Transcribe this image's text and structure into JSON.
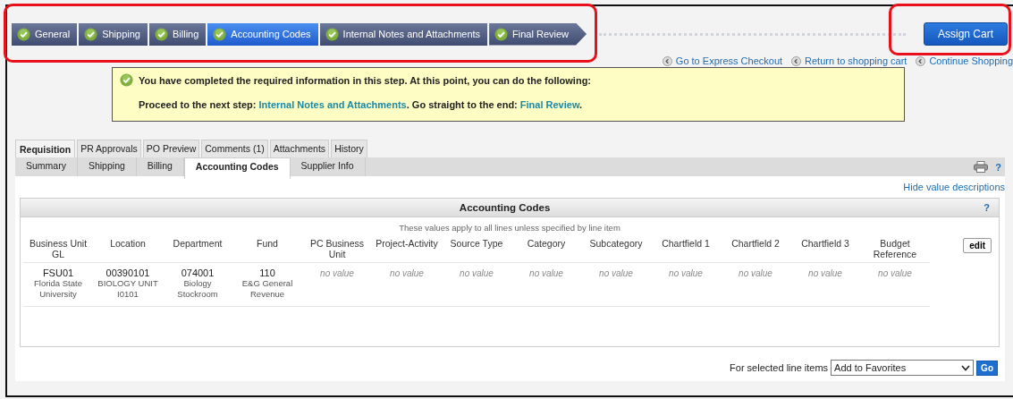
{
  "steps": [
    {
      "label": "General",
      "completed": true,
      "selected": false
    },
    {
      "label": "Shipping",
      "completed": true,
      "selected": false
    },
    {
      "label": "Billing",
      "completed": true,
      "selected": false
    },
    {
      "label": "Accounting Codes",
      "completed": true,
      "selected": true
    },
    {
      "label": "Internal Notes and Attachments",
      "completed": true,
      "selected": false
    },
    {
      "label": "Final Review",
      "completed": true,
      "selected": false
    }
  ],
  "assign_button": "Assign Cart",
  "links": [
    "Go to Express Checkout",
    "Return to shopping cart",
    "Continue Shopping"
  ],
  "message": {
    "title": "You have completed the required information in this step. At this point, you can do the following:",
    "segments": [
      {
        "kind": "text",
        "text": "Proceed to the next step: "
      },
      {
        "kind": "link",
        "text": "Internal Notes and Attachments"
      },
      {
        "kind": "text",
        "text": ". Go straight to the end: "
      },
      {
        "kind": "link",
        "text": "Final Review"
      },
      {
        "kind": "text",
        "text": "."
      }
    ]
  },
  "tabs": [
    {
      "label": "Requisition",
      "selected": true
    },
    {
      "label": "PR Approvals",
      "selected": false
    },
    {
      "label": "PO Preview",
      "selected": false
    },
    {
      "label": "Comments (1)",
      "selected": false
    },
    {
      "label": "Attachments",
      "selected": false
    },
    {
      "label": "History",
      "selected": false
    }
  ],
  "subtabs": [
    {
      "label": "Summary",
      "selected": false
    },
    {
      "label": "Shipping",
      "selected": false
    },
    {
      "label": "Billing",
      "selected": false
    },
    {
      "label": "Accounting Codes",
      "selected": true
    },
    {
      "label": "Supplier Info",
      "selected": false
    }
  ],
  "help": "?",
  "hide_link": "Hide value descriptions",
  "panel": {
    "title": "Accounting Codes",
    "help": "?",
    "subtitle": "These values apply to all lines unless specified by line item",
    "edit_button": "edit",
    "columns": [
      "Business Unit GL",
      "Location",
      "Department",
      "Fund",
      "PC Business Unit",
      "Project-Activity",
      "Source Type",
      "Category",
      "Subcategory",
      "Chartfield 1",
      "Chartfield 2",
      "Chartfield 3",
      "Budget Reference"
    ],
    "rows": [
      {
        "cells": [
          {
            "kind": "code",
            "code": "FSU01",
            "description": "Florida State University"
          },
          {
            "kind": "code",
            "code": "00390101",
            "description": "BIOLOGY UNIT I0101"
          },
          {
            "kind": "code",
            "code": "074001",
            "description": "Biology Stockroom"
          },
          {
            "kind": "code",
            "code": "110",
            "description": "E&G General Revenue"
          },
          {
            "kind": "empty",
            "text": "no value"
          },
          {
            "kind": "empty",
            "text": "no value"
          },
          {
            "kind": "empty",
            "text": "no value"
          },
          {
            "kind": "empty",
            "text": "no value"
          },
          {
            "kind": "empty",
            "text": "no value"
          },
          {
            "kind": "empty",
            "text": "no value"
          },
          {
            "kind": "empty",
            "text": "no value"
          },
          {
            "kind": "empty",
            "text": "no value"
          },
          {
            "kind": "empty",
            "text": "no value"
          }
        ]
      }
    ]
  },
  "bulk": {
    "label": "For selected line items",
    "value": "Add to Favorites",
    "button": "Go"
  }
}
